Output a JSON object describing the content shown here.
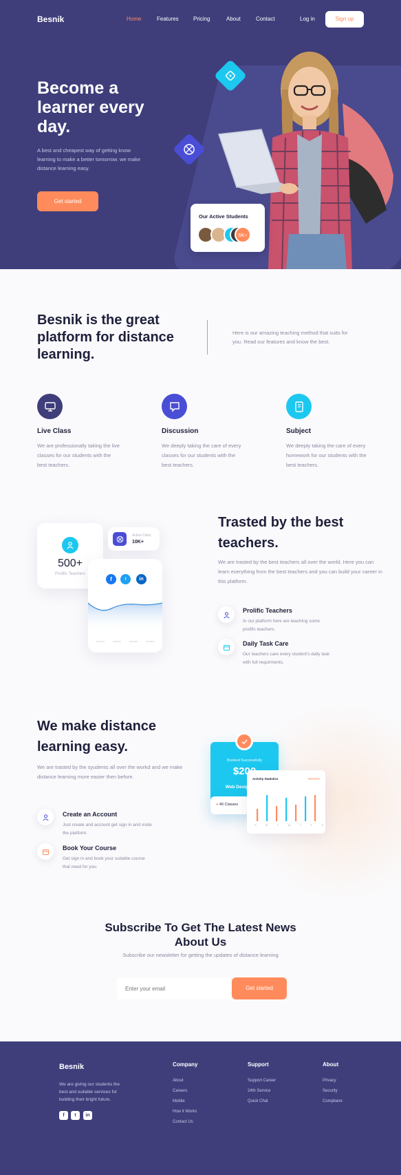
{
  "brand": "Besnik",
  "nav": {
    "items": [
      "Home",
      "Features",
      "Pricing",
      "About",
      "Contact"
    ],
    "active": "Home",
    "login": "Log in",
    "signup": "Sign up"
  },
  "hero": {
    "title": "Become a learner every day.",
    "description": "A best and cheapest way of getting know learning to make a better tomorrow. we make distance learning easy.",
    "cta": "Get started",
    "students_card": {
      "title": "Our Active Students",
      "count": "5K+"
    }
  },
  "platform": {
    "title": "Besnik is the great platform for distance learning.",
    "description": "Here is our amazing teaching method that suits for you. Read our features and know the best.",
    "features": [
      {
        "icon": "monitor-icon",
        "title": "Live Class",
        "description": "We are professionally taking the live classes for our students with the best teachers."
      },
      {
        "icon": "chat-icon",
        "title": "Discussion",
        "description": "We deeply taking the care of every classes for our students with the best teachers."
      },
      {
        "icon": "book-icon",
        "title": "Subject",
        "description": "We deeply taking the care of every homework for our students with the best teachers."
      }
    ]
  },
  "teachers": {
    "stat_value": "500+",
    "stat_label": "Prolific Teachers",
    "active_class_label": "Active Class",
    "active_class_value": "10K+",
    "title": "Trasted by the best teachers.",
    "description": "We are trasted by the best teachers all over the world. Here you can learn everything from the best teachers and you can build your career in this platform.",
    "items": [
      {
        "icon": "user-icon",
        "title": "Prolific Teachers",
        "description": "In our platform here are teaching some prolific teachers."
      },
      {
        "icon": "calendar-icon",
        "title": "Daily Task Care",
        "description": "Our teachers care every student's daily task with full requirments."
      }
    ]
  },
  "easy": {
    "title": "We make distance learning easy.",
    "description": "We are trasted by the syudents all over the workd and we make distance learning more easier then before.",
    "items": [
      {
        "icon": "user-icon",
        "title": "Create an Account",
        "description": "Just create and account get sign in and visite the platform."
      },
      {
        "icon": "calendar-icon",
        "title": "Book Your Course",
        "description": "Get sign in and book your suitable course that need for you."
      }
    ],
    "booking_card": {
      "status": "Booked Successfully",
      "price": "$200",
      "course": "Web Design & D...",
      "classes": "40 Classes"
    },
    "activity_card": {
      "title": "Activity Statistics",
      "days": [
        "S",
        "M",
        "T",
        "W",
        "T",
        "F",
        "S"
      ]
    }
  },
  "subscribe": {
    "title": "Subscribe To Get The Latest News About Us",
    "description": "Subscribe our newsletter for getting the updates of distance learning",
    "placeholder": "Enter your email",
    "button": "Get started"
  },
  "footer": {
    "brand": "Besnik",
    "description": "We are giving our students the best and suitable services for building their bright future.",
    "columns": [
      {
        "title": "Company",
        "links": [
          "About",
          "Careers",
          "Mobile",
          "How it Works",
          "Contact Us"
        ]
      },
      {
        "title": "Support",
        "links": [
          "Support Career",
          "24th Service",
          "Quick Chat"
        ]
      },
      {
        "title": "About",
        "links": [
          "Privacy",
          "Security",
          "Compliane"
        ]
      }
    ]
  },
  "colors": {
    "primary": "#3f3e7b",
    "accent": "#ff8b5c",
    "cyan": "#1cc8ef",
    "indigo": "#4a4ed6"
  }
}
